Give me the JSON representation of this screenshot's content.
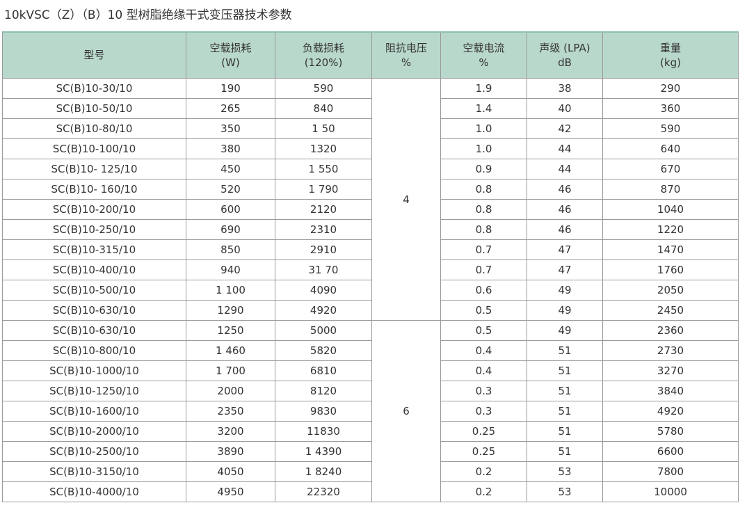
{
  "title": "10kVSC（Z）（B）10 型树脂绝缘干式变压器技术参数",
  "headers": [
    {
      "line1": "型号",
      "line2": ""
    },
    {
      "line1": "空载损耗",
      "line2": "(W)"
    },
    {
      "line1": "负载损耗",
      "line2": "(120%)"
    },
    {
      "line1": "阻抗电压",
      "line2": "%"
    },
    {
      "line1": "空载电流",
      "line2": "%"
    },
    {
      "line1": "声级 (LPA)",
      "line2": "dB"
    },
    {
      "line1": "重量",
      "line2": "(kg)"
    }
  ],
  "impedance_groups": [
    {
      "value": "4",
      "rows": 12
    },
    {
      "value": "6",
      "rows": 9
    }
  ],
  "rows": [
    {
      "model": "SC(B)10-30/10",
      "no_load_loss": "190",
      "load_loss": "590",
      "no_load_current": "1.9",
      "sound": "38",
      "weight": "290"
    },
    {
      "model": "SC(B)10-50/10",
      "no_load_loss": "265",
      "load_loss": "840",
      "no_load_current": "1.4",
      "sound": "40",
      "weight": "360"
    },
    {
      "model": "SC(B)10-80/10",
      "no_load_loss": "350",
      "load_loss": "1 50",
      "no_load_current": "1.0",
      "sound": "42",
      "weight": "590"
    },
    {
      "model": "SC(B)10-100/10",
      "no_load_loss": "380",
      "load_loss": "1320",
      "no_load_current": "1.0",
      "sound": "44",
      "weight": "640"
    },
    {
      "model": "SC(B)10- 125/10",
      "no_load_loss": "450",
      "load_loss": "1 550",
      "no_load_current": "0.9",
      "sound": "44",
      "weight": "670"
    },
    {
      "model": "SC(B)10- 160/10",
      "no_load_loss": "520",
      "load_loss": "1 790",
      "no_load_current": "0.8",
      "sound": "46",
      "weight": "870"
    },
    {
      "model": "SC(B)10-200/10",
      "no_load_loss": "600",
      "load_loss": "2120",
      "no_load_current": "0.8",
      "sound": "46",
      "weight": "1040"
    },
    {
      "model": "SC(B)10-250/10",
      "no_load_loss": "690",
      "load_loss": "2310",
      "no_load_current": "0.8",
      "sound": "46",
      "weight": "1220"
    },
    {
      "model": "SC(B)10-315/10",
      "no_load_loss": "850",
      "load_loss": "2910",
      "no_load_current": "0.7",
      "sound": "47",
      "weight": "1470"
    },
    {
      "model": "SC(B)10-400/10",
      "no_load_loss": "940",
      "load_loss": "31 70",
      "no_load_current": "0.7",
      "sound": "47",
      "weight": "1760"
    },
    {
      "model": "SC(B)10-500/10",
      "no_load_loss": "1 100",
      "load_loss": "4090",
      "no_load_current": "0.6",
      "sound": "49",
      "weight": "2050"
    },
    {
      "model": "SC(B)10-630/10",
      "no_load_loss": "1290",
      "load_loss": "4920",
      "no_load_current": "0.5",
      "sound": "49",
      "weight": "2450"
    },
    {
      "model": "SC(B)10-630/10",
      "no_load_loss": "1250",
      "load_loss": "5000",
      "no_load_current": "0.5",
      "sound": "49",
      "weight": "2360"
    },
    {
      "model": "SC(B)10-800/10",
      "no_load_loss": "1 460",
      "load_loss": "5820",
      "no_load_current": "0.4",
      "sound": "51",
      "weight": "2730"
    },
    {
      "model": "SC(B)10-1000/10",
      "no_load_loss": "1 700",
      "load_loss": "6810",
      "no_load_current": "0.4",
      "sound": "51",
      "weight": "3270"
    },
    {
      "model": "SC(B)10-1250/10",
      "no_load_loss": "2000",
      "load_loss": "8120",
      "no_load_current": "0.3",
      "sound": "51",
      "weight": "3840"
    },
    {
      "model": "SC(B)10-1600/10",
      "no_load_loss": "2350",
      "load_loss": "9830",
      "no_load_current": "0.3",
      "sound": "51",
      "weight": "4920"
    },
    {
      "model": "SC(B)10-2000/10",
      "no_load_loss": "3200",
      "load_loss": "11830",
      "no_load_current": "0.25",
      "sound": "51",
      "weight": "5780"
    },
    {
      "model": "SC(B)10-2500/10",
      "no_load_loss": "3890",
      "load_loss": "1 4390",
      "no_load_current": "0.25",
      "sound": "51",
      "weight": "6600"
    },
    {
      "model": "SC(B)10-3150/10",
      "no_load_loss": "4050",
      "load_loss": "1 8240",
      "no_load_current": "0.2",
      "sound": "53",
      "weight": "7800"
    },
    {
      "model": "SC(B)10-4000/10",
      "no_load_loss": "4950",
      "load_loss": "22320",
      "no_load_current": "0.2",
      "sound": "53",
      "weight": "10000"
    }
  ]
}
